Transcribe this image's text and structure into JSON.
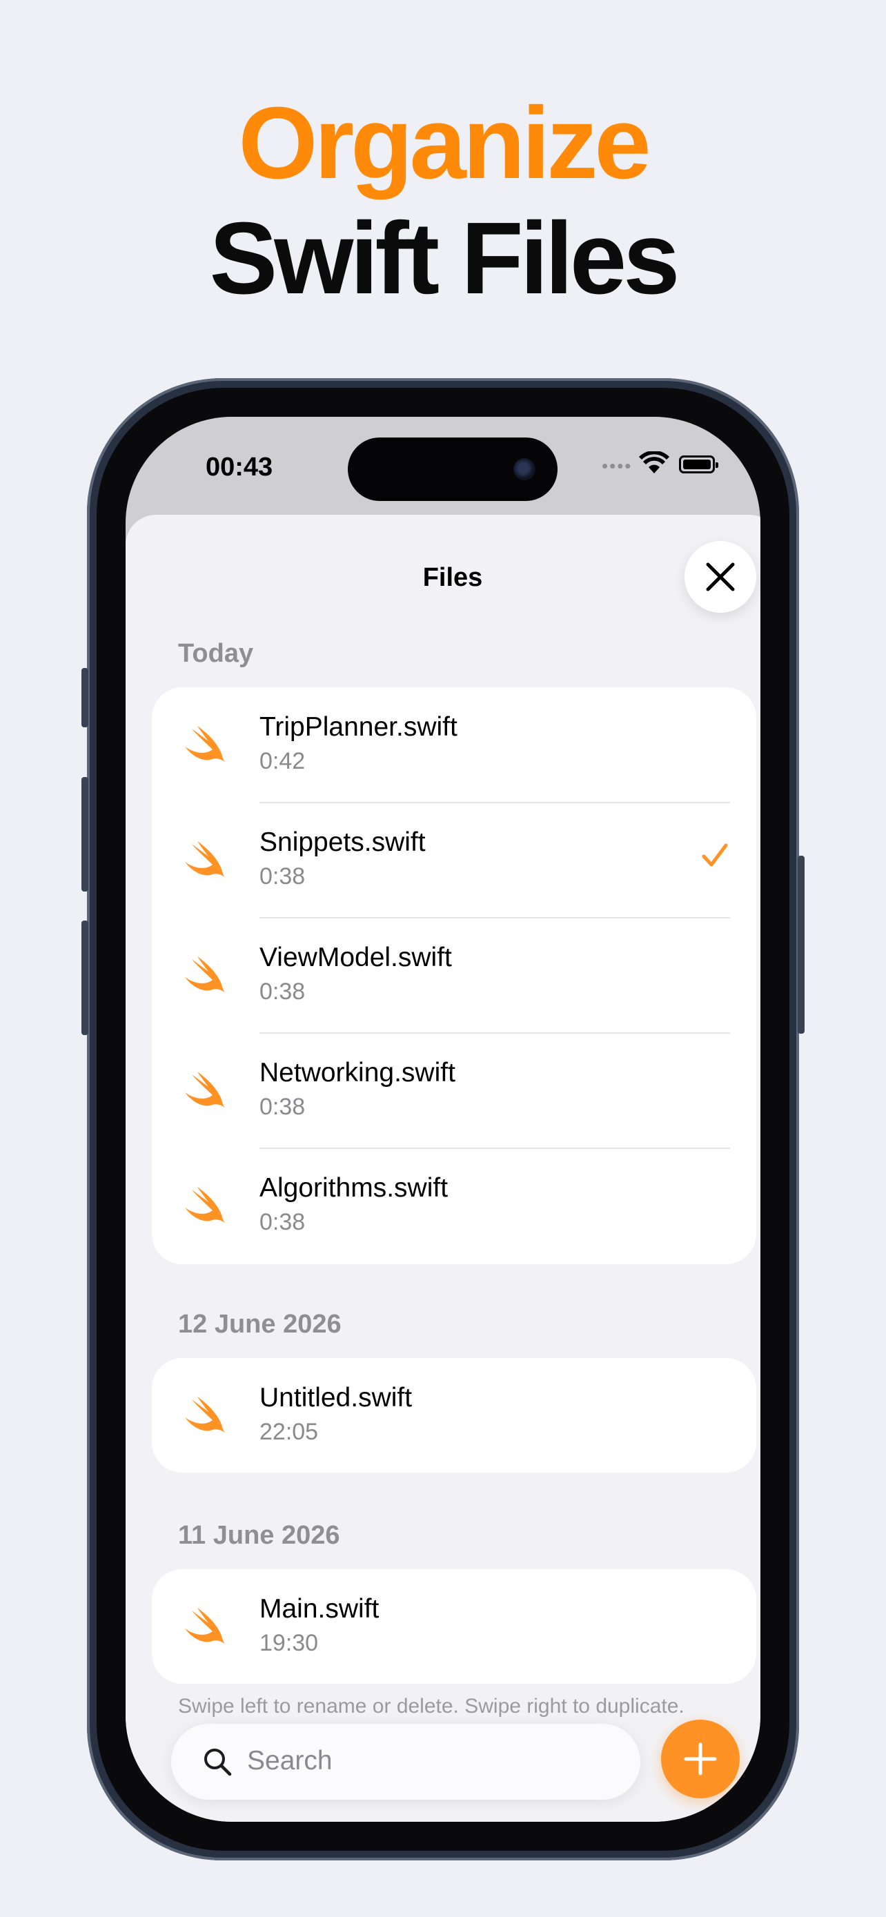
{
  "headline": {
    "line1": "Organize",
    "line2": "Swift Files"
  },
  "colors": {
    "accent": "#ff8a0a",
    "swift_icon": "#ff9224"
  },
  "status_bar": {
    "time": "00:43",
    "more": "••••",
    "battery_level": 1.0
  },
  "sheet": {
    "title": "Files",
    "close_icon": "xmark-icon",
    "sections": [
      {
        "label": "Today",
        "items": [
          {
            "name": "TripPlanner.swift",
            "time": "0:42",
            "selected": false
          },
          {
            "name": "Snippets.swift",
            "time": "0:38",
            "selected": true
          },
          {
            "name": "ViewModel.swift",
            "time": "0:38",
            "selected": false
          },
          {
            "name": "Networking.swift",
            "time": "0:38",
            "selected": false
          },
          {
            "name": "Algorithms.swift",
            "time": "0:38",
            "selected": false
          }
        ]
      },
      {
        "label": "12 June 2026",
        "items": [
          {
            "name": "Untitled.swift",
            "time": "22:05",
            "selected": false
          }
        ]
      },
      {
        "label": "11 June 2026",
        "items": [
          {
            "name": "Main.swift",
            "time": "19:30",
            "selected": false
          }
        ]
      }
    ],
    "hint": "Swipe left to rename or delete. Swipe right to duplicate.",
    "search": {
      "placeholder": "Search",
      "icon": "magnifyingglass-icon"
    },
    "add_icon": "plus-icon"
  }
}
